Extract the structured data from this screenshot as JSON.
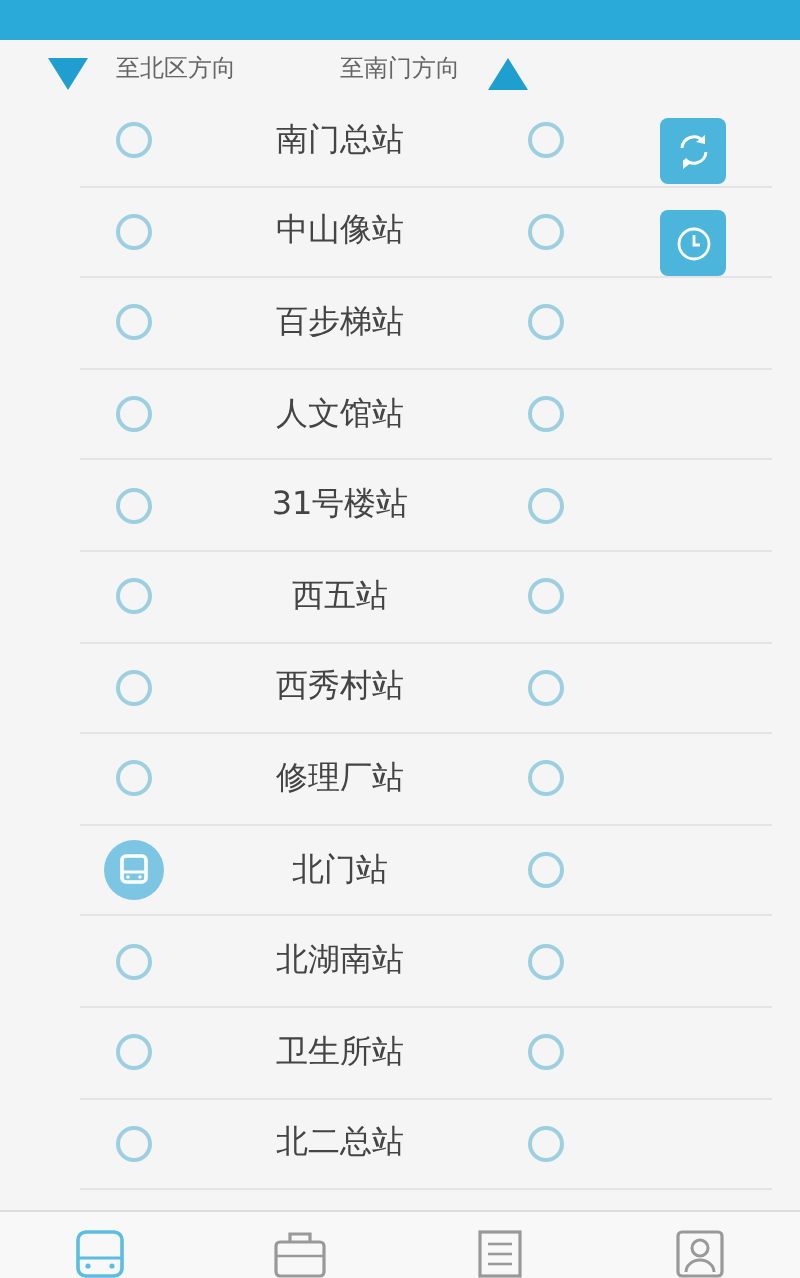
{
  "directions": [
    {
      "label": "至北区方向",
      "kind": "down"
    },
    {
      "label": "至南门方向",
      "kind": "up"
    }
  ],
  "stations": [
    {
      "name": "南门总站",
      "bus_north": false,
      "bus_south": false
    },
    {
      "name": "中山像站",
      "bus_north": false,
      "bus_south": false
    },
    {
      "name": "百步梯站",
      "bus_north": false,
      "bus_south": false
    },
    {
      "name": "人文馆站",
      "bus_north": false,
      "bus_south": false
    },
    {
      "name": "31号楼站",
      "bus_north": false,
      "bus_south": false
    },
    {
      "name": "西五站",
      "bus_north": false,
      "bus_south": false
    },
    {
      "name": "西秀村站",
      "bus_north": false,
      "bus_south": false
    },
    {
      "name": "修理厂站",
      "bus_north": false,
      "bus_south": false
    },
    {
      "name": "北门站",
      "bus_north": true,
      "bus_south": false
    },
    {
      "name": "北湖南站",
      "bus_north": false,
      "bus_south": false
    },
    {
      "name": "卫生所站",
      "bus_north": false,
      "bus_south": false
    },
    {
      "name": "北二总站",
      "bus_north": false,
      "bus_south": false
    }
  ],
  "side_buttons": [
    {
      "kind": "refresh"
    },
    {
      "kind": "clock"
    }
  ],
  "nav": [
    {
      "kind": "bus",
      "selected": true
    },
    {
      "kind": "briefcase",
      "selected": false
    },
    {
      "kind": "document",
      "selected": false
    },
    {
      "kind": "person",
      "selected": false
    }
  ]
}
